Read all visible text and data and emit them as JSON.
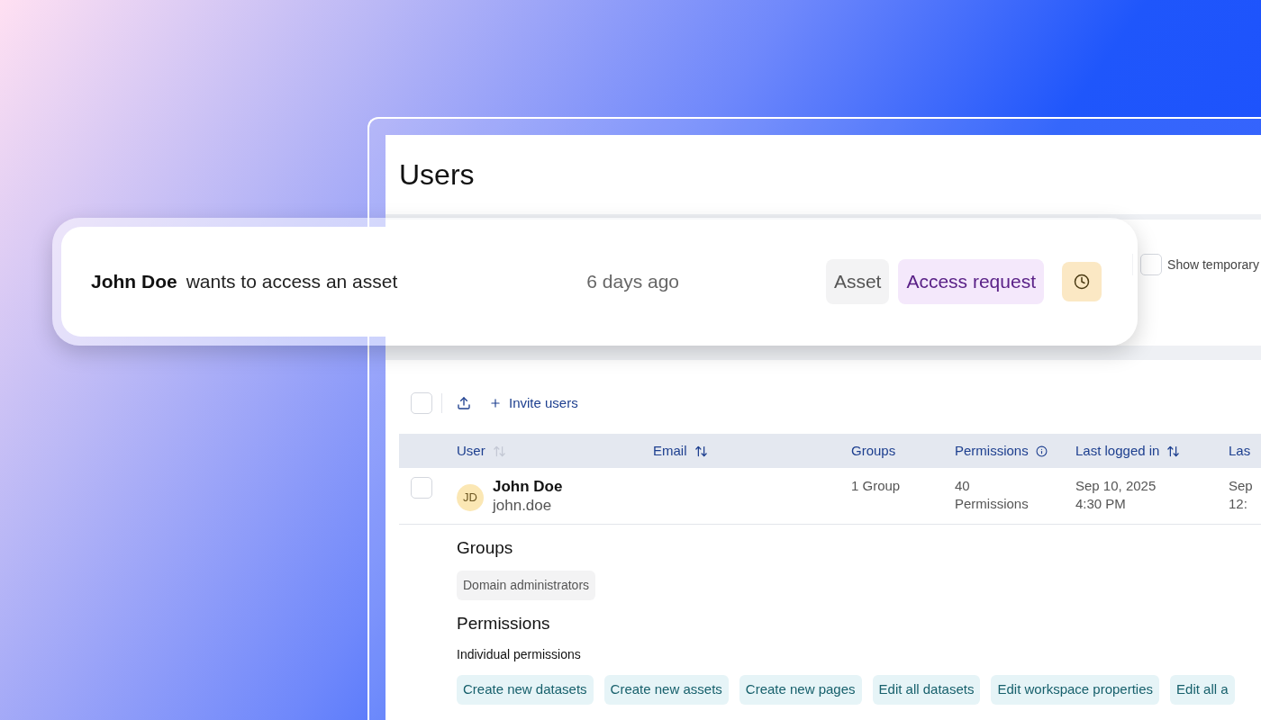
{
  "page_header": {
    "title": "Users"
  },
  "filters": {
    "show_temporary": {
      "label": "Show temporary",
      "checked": false
    }
  },
  "notification": {
    "actor": "John Doe",
    "message": "wants to access an asset",
    "time": "6 days ago",
    "tags": [
      {
        "label": "Asset",
        "kind": "neutral"
      },
      {
        "label": "Access request",
        "kind": "accent"
      }
    ]
  },
  "toolbar": {
    "select_all_checked": false,
    "invite_label": "Invite users"
  },
  "table": {
    "columns": [
      {
        "label": "User",
        "kind": "sort_inactive"
      },
      {
        "label": "Email",
        "kind": "sort"
      },
      {
        "label": "Groups",
        "kind": "plain"
      },
      {
        "label": "Permissions",
        "kind": "info"
      },
      {
        "label": "Last logged in",
        "kind": "sort"
      },
      {
        "label": "Las",
        "kind": "plain"
      }
    ],
    "rows": [
      {
        "checked": false,
        "expanded": true,
        "initials": "JD",
        "name": "John Doe",
        "username": "john.doe",
        "groups": "1 Group",
        "permission_count": "40",
        "permission_label": "Permissions",
        "last_logged_in_date": "Sep 10, 2025",
        "last_logged_in_time": "4:30 PM",
        "column_7_date": "Sep",
        "column_7_time": "12:",
        "details": {
          "groups_heading": "Groups",
          "group_chips": [
            "Domain administrators"
          ],
          "permissions_heading": "Permissions",
          "individual_label": "Individual permissions",
          "permission_chips": [
            "Create new datasets",
            "Create new assets",
            "Create new pages",
            "Edit all datasets",
            "Edit workspace properties",
            "Edit all a"
          ]
        }
      }
    ]
  }
}
